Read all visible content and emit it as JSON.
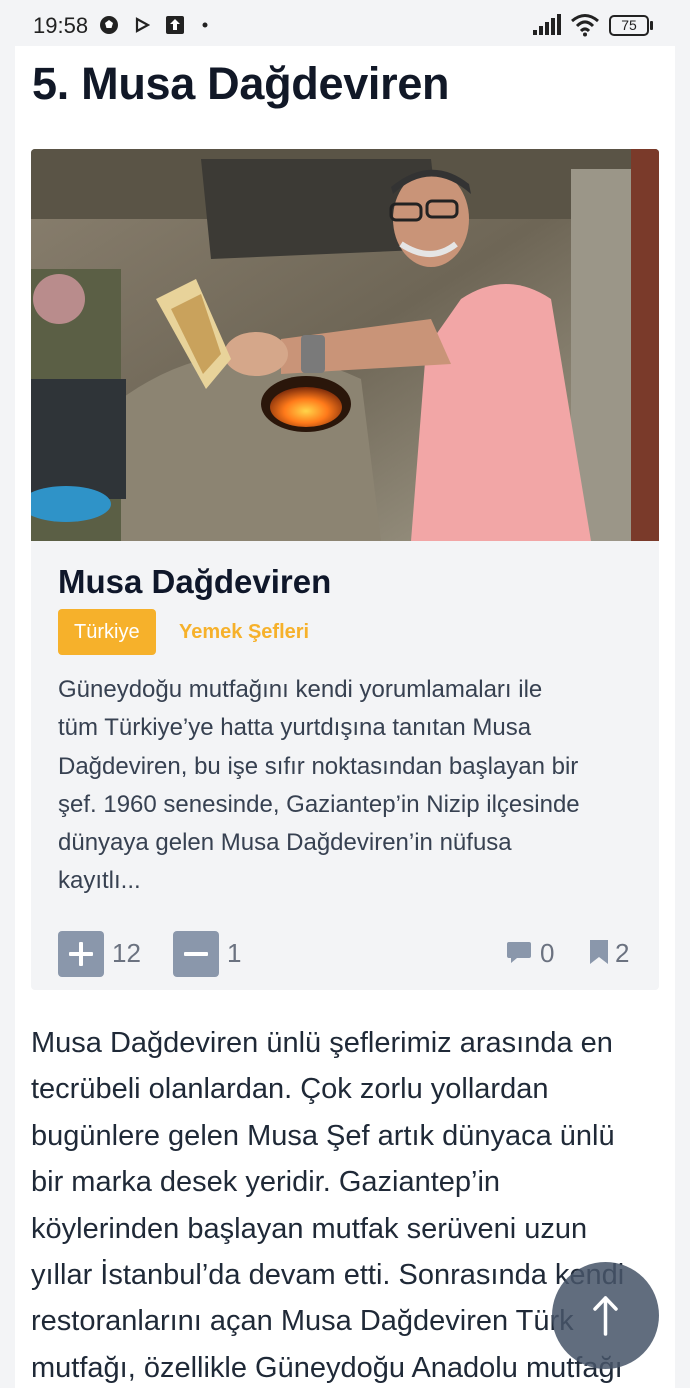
{
  "status_bar": {
    "time": "19:58",
    "battery": "75",
    "icons": [
      "soccer-ball-icon",
      "play-icon",
      "upload-icon",
      "dot-icon",
      "signal-icon",
      "wifi-icon",
      "battery-icon"
    ]
  },
  "section": {
    "title": "5. Musa Dağdeviren"
  },
  "card": {
    "image_alt": "chef-holding-bread-at-oven",
    "title": "Musa Dağdeviren",
    "tag_country": "Türkiye",
    "tag_category": "Yemek Şefleri",
    "description_lines": [
      "Güneydoğu mutfağını kendi yorumlamaları ile",
      "tüm Türkiye’ye hatta yurtdışına tanıtan Musa",
      "Dağdeviren, bu işe sıfır noktasından başlayan bir",
      "şef. 1960 senesinde, Gaziantep’in Nizip ilçesinde",
      "dünyaya gelen Musa Dağdeviren’in nüfusa",
      "kayıtlı..."
    ],
    "upvotes": "12",
    "downvotes": "1",
    "comments": "0",
    "bookmarks": "2"
  },
  "article": {
    "lines": [
      "Musa Dağdeviren ünlü şeflerimiz arasında en",
      "tecrübeli olanlardan. Çok zorlu yollardan",
      "bugünlere gelen Musa Şef artık dünyaca ünlü",
      "bir marka desek yeridir. Gaziantep’in",
      "köylerinden başlayan mutfak serüveni uzun",
      "yıllar İstanbul’da devam etti. Sonrasında kendi",
      "restoranlarını açan Musa Dağdeviren Türk",
      "mutfağı, özellikle Güneydoğu Anadolu mutfağı"
    ]
  },
  "colors": {
    "accent": "#f6b12b",
    "vote_button": "#8a97ab",
    "card_bg": "#f3f4f6",
    "fab": "#475569"
  }
}
